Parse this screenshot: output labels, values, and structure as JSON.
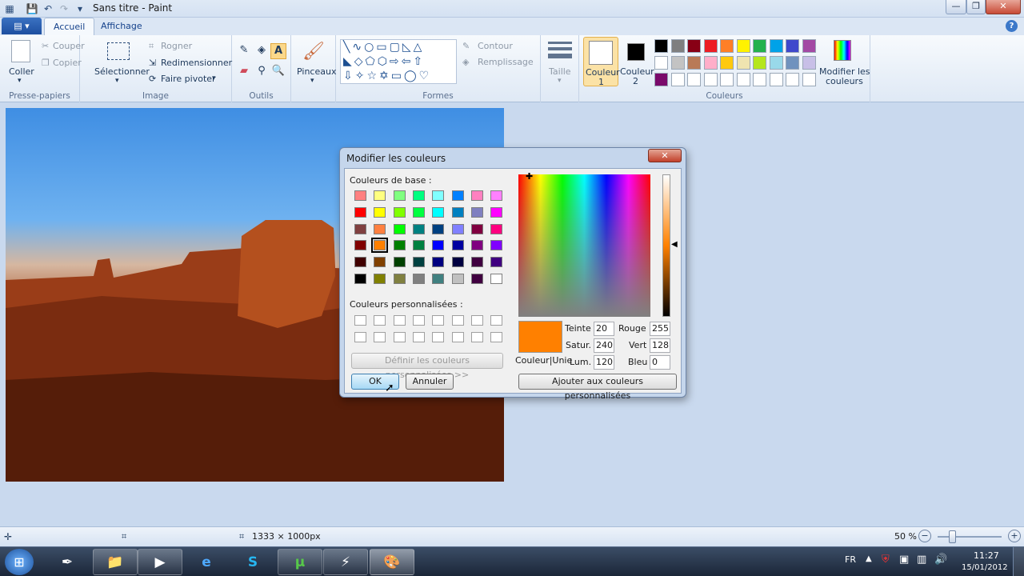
{
  "window": {
    "title": "Sans titre - Paint",
    "min": "—",
    "max": "❐",
    "close": "✕"
  },
  "quick_access": {
    "save_icon": "save-icon",
    "undo_icon": "undo-icon",
    "redo_icon": "redo-icon"
  },
  "tabs": [
    {
      "label": "Accueil"
    },
    {
      "label": "Affichage"
    }
  ],
  "appmenu": {
    "label": "▤ ▾"
  },
  "help": "?",
  "ribbon": {
    "clipboard": {
      "paste": "Coller",
      "cut": "Couper",
      "copy": "Copier",
      "group": "Presse-papiers"
    },
    "image": {
      "select": "Sélectionner",
      "crop": "Rogner",
      "resize": "Redimensionner",
      "rotate": "Faire pivoter",
      "group": "Image"
    },
    "tools": {
      "group": "Outils"
    },
    "brushes": {
      "label": "Pinceaux"
    },
    "shapes": {
      "outline": "Contour",
      "fill": "Remplissage",
      "group": "Formes"
    },
    "size": {
      "label": "Taille"
    },
    "colors": {
      "color1": "Couleur\n1",
      "color1_a": "Couleur",
      "color1_b": "1",
      "color2_a": "Couleur",
      "color2_b": "2",
      "edit_a": "Modifier les",
      "edit_b": "couleurs",
      "group": "Couleurs",
      "palette_row1": [
        "#000000",
        "#7f7f7f",
        "#880015",
        "#ed1c24",
        "#ff7f27",
        "#fff200",
        "#22b14c",
        "#00a2e8",
        "#3f48cc",
        "#a349a4"
      ],
      "palette_row2": [
        "#ffffff",
        "#c3c3c3",
        "#b97a57",
        "#ffaec9",
        "#ffc90e",
        "#efe4b0",
        "#b5e61d",
        "#99d9ea",
        "#7092be",
        "#c8bfe7"
      ],
      "palette_row3": [
        "#7a0a6b",
        "#ffffff",
        "#ffffff",
        "#ffffff",
        "#ffffff",
        "#ffffff",
        "#ffffff",
        "#ffffff",
        "#ffffff",
        "#ffffff"
      ]
    }
  },
  "dialog": {
    "title": "Modifier les couleurs",
    "close": "✕",
    "base_label": "Couleurs de base :",
    "custom_label": "Couleurs personnalisées :",
    "define_custom": "Définir les couleurs personnalisées >>",
    "ok": "OK",
    "cancel": "Annuler",
    "add_custom": "Ajouter aux couleurs personnalisées",
    "solid_label": "Couleur|Unie",
    "current_color": "#ff8000",
    "hue_label": "Teinte :",
    "hue": "20",
    "sat_label": "Satur. :",
    "sat": "240",
    "lum_label": "Lum. :",
    "lum": "120",
    "red_label": "Rouge :",
    "red": "255",
    "green_label": "Vert :",
    "green": "128",
    "blue_label": "Bleu :",
    "blue": "0",
    "base_colors": [
      [
        "#ff8080",
        "#ffff80",
        "#80ff80",
        "#00ff80",
        "#80ffff",
        "#0080ff",
        "#ff80c0",
        "#ff80ff"
      ],
      [
        "#ff0000",
        "#ffff00",
        "#80ff00",
        "#00ff40",
        "#00ffff",
        "#0080c0",
        "#8080c0",
        "#ff00ff"
      ],
      [
        "#804040",
        "#ff8040",
        "#00ff00",
        "#008080",
        "#004080",
        "#8080ff",
        "#800040",
        "#ff0080"
      ],
      [
        "#800000",
        "#ff8000",
        "#008000",
        "#008040",
        "#0000ff",
        "#0000a0",
        "#800080",
        "#8000ff"
      ],
      [
        "#400000",
        "#804000",
        "#004000",
        "#004040",
        "#000080",
        "#000040",
        "#400040",
        "#400080"
      ],
      [
        "#000000",
        "#808000",
        "#808040",
        "#808080",
        "#408080",
        "#c0c0c0",
        "#400040",
        "#ffffff"
      ]
    ]
  },
  "status": {
    "size": "1333 × 1000px",
    "zoom": "50 %"
  },
  "taskbar": {
    "lang": "FR",
    "time": "11:27",
    "date": "15/01/2012"
  }
}
